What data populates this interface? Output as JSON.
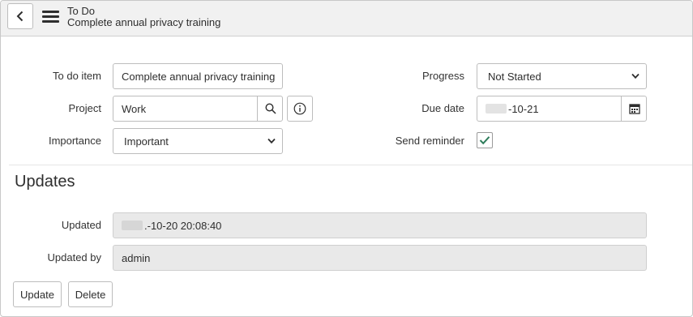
{
  "header": {
    "title": "To Do",
    "subtitle": "Complete annual privacy training"
  },
  "form": {
    "todo_item": {
      "label": "To do item",
      "value": "Complete annual privacy training"
    },
    "project": {
      "label": "Project",
      "value": "Work"
    },
    "importance": {
      "label": "Importance",
      "value": "Important"
    },
    "progress": {
      "label": "Progress",
      "value": "Not Started"
    },
    "due_date": {
      "label": "Due date",
      "value": "-10-21"
    },
    "send_reminder": {
      "label": "Send reminder",
      "checked": true
    }
  },
  "updates": {
    "title": "Updates",
    "updated": {
      "label": "Updated",
      "value": ".-10-20 20:08:40"
    },
    "updated_by": {
      "label": "Updated by",
      "value": "admin"
    }
  },
  "actions": {
    "update_label": "Update",
    "delete_label": "Delete"
  },
  "colors": {
    "check": "#2e7d5b",
    "header_bg": "#f1f1f1"
  },
  "icons": [
    "chevron-left-icon",
    "menu-icon",
    "search-icon",
    "info-icon",
    "calendar-icon",
    "chevron-down-icon",
    "checkmark-icon"
  ]
}
